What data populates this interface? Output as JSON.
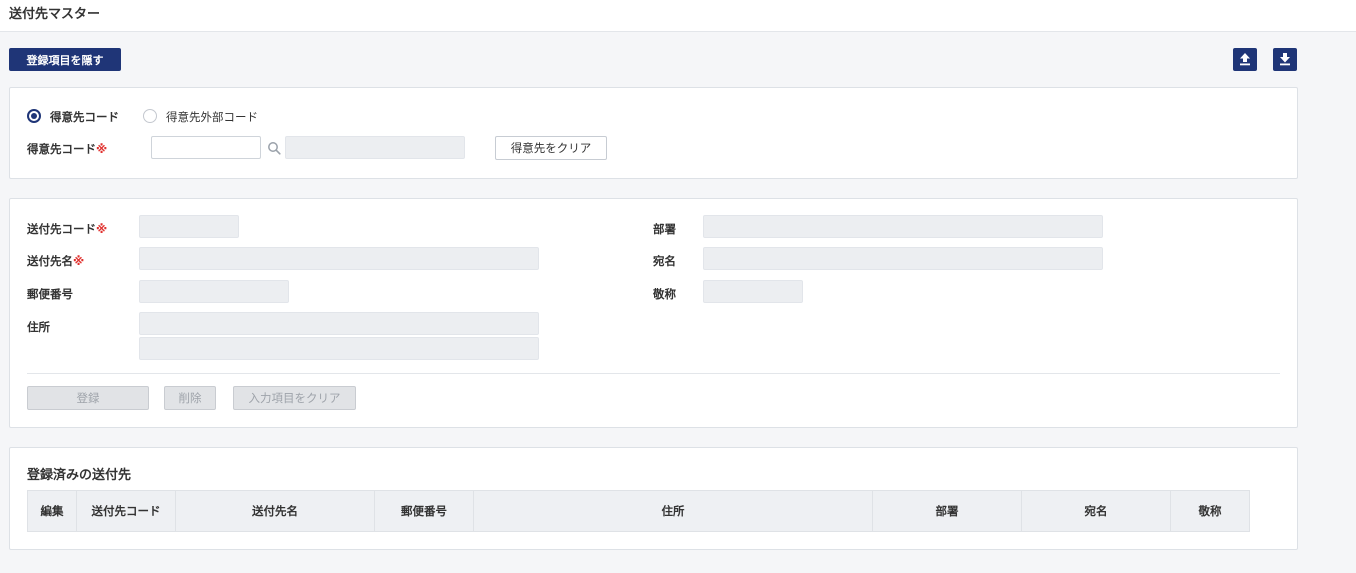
{
  "header": {
    "title": "送付先マスター"
  },
  "toolbar": {
    "toggle_label": "登録項目を隠す",
    "upload_icon": "upload-icon",
    "download_icon": "download-icon",
    "accent": "#1f3577"
  },
  "customer": {
    "radio_code": "得意先コード",
    "radio_external": "得意先外部コード",
    "code_label": "得意先コード",
    "required_mark": "※",
    "code_value": "",
    "name_value": "",
    "clear_label": "得意先をクリア"
  },
  "form": {
    "dest_code_label": "送付先コード",
    "dest_name_label": "送付先名",
    "postal_label": "郵便番号",
    "address_label": "住所",
    "dept_label": "部署",
    "addressee_label": "宛名",
    "honorific_label": "敬称",
    "required_mark": "※",
    "register_label": "登録",
    "delete_label": "削除",
    "clear_label": "入力項目をクリア"
  },
  "registered": {
    "title": "登録済みの送付先",
    "columns": [
      "編集",
      "送付先コード",
      "送付先名",
      "郵便番号",
      "住所",
      "部署",
      "宛名",
      "敬称"
    ],
    "rows": []
  }
}
